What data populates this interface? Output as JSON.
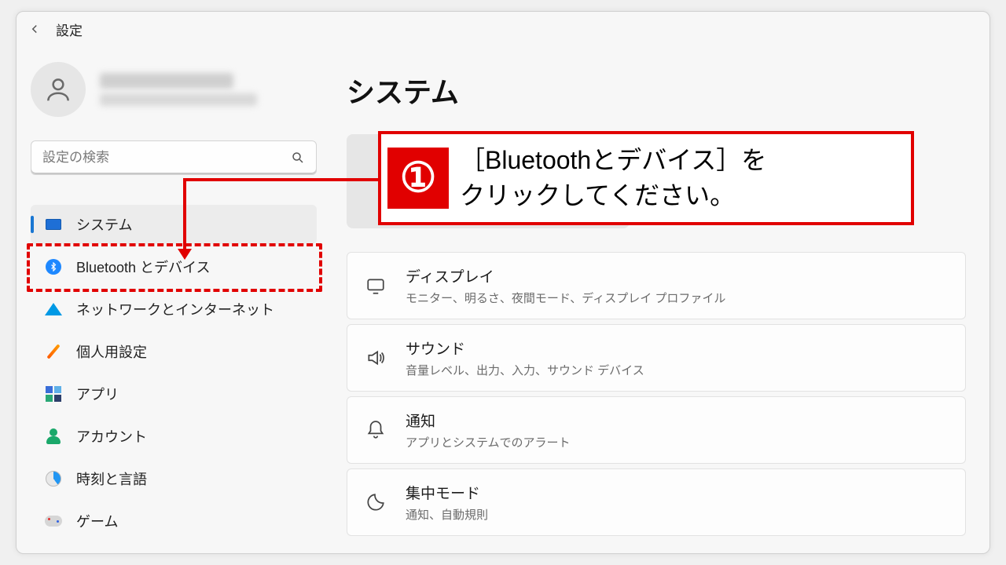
{
  "header": {
    "title": "設定"
  },
  "account": {
    "name_redacted": true
  },
  "search": {
    "placeholder": "設定の検索"
  },
  "sidebar": {
    "items": [
      {
        "id": "system",
        "label": "システム",
        "icon": "system-icon",
        "selected": true
      },
      {
        "id": "bluetooth",
        "label": "Bluetooth とデバイス",
        "icon": "bluetooth-icon",
        "selected": false
      },
      {
        "id": "network",
        "label": "ネットワークとインターネット",
        "icon": "network-icon",
        "selected": false
      },
      {
        "id": "personalization",
        "label": "個人用設定",
        "icon": "personalization-icon",
        "selected": false
      },
      {
        "id": "apps",
        "label": "アプリ",
        "icon": "apps-icon",
        "selected": false
      },
      {
        "id": "accounts",
        "label": "アカウント",
        "icon": "accounts-icon",
        "selected": false
      },
      {
        "id": "time",
        "label": "時刻と言語",
        "icon": "time-language-icon",
        "selected": false
      },
      {
        "id": "gaming",
        "label": "ゲーム",
        "icon": "gaming-icon",
        "selected": false
      }
    ]
  },
  "main": {
    "title": "システム",
    "settings": [
      {
        "id": "display",
        "title": "ディスプレイ",
        "desc": "モニター、明るさ、夜間モード、ディスプレイ プロファイル",
        "icon": "display-icon"
      },
      {
        "id": "sound",
        "title": "サウンド",
        "desc": "音量レベル、出力、入力、サウンド デバイス",
        "icon": "sound-icon"
      },
      {
        "id": "notif",
        "title": "通知",
        "desc": "アプリとシステムでのアラート",
        "icon": "notification-icon"
      },
      {
        "id": "focus",
        "title": "集中モード",
        "desc": "通知、自動規則",
        "icon": "focus-icon"
      }
    ]
  },
  "annotation": {
    "step": "①",
    "text_line1": "［Bluetoothとデバイス］を",
    "text_line2": "クリックしてください。",
    "highlight_target": "bluetooth"
  }
}
